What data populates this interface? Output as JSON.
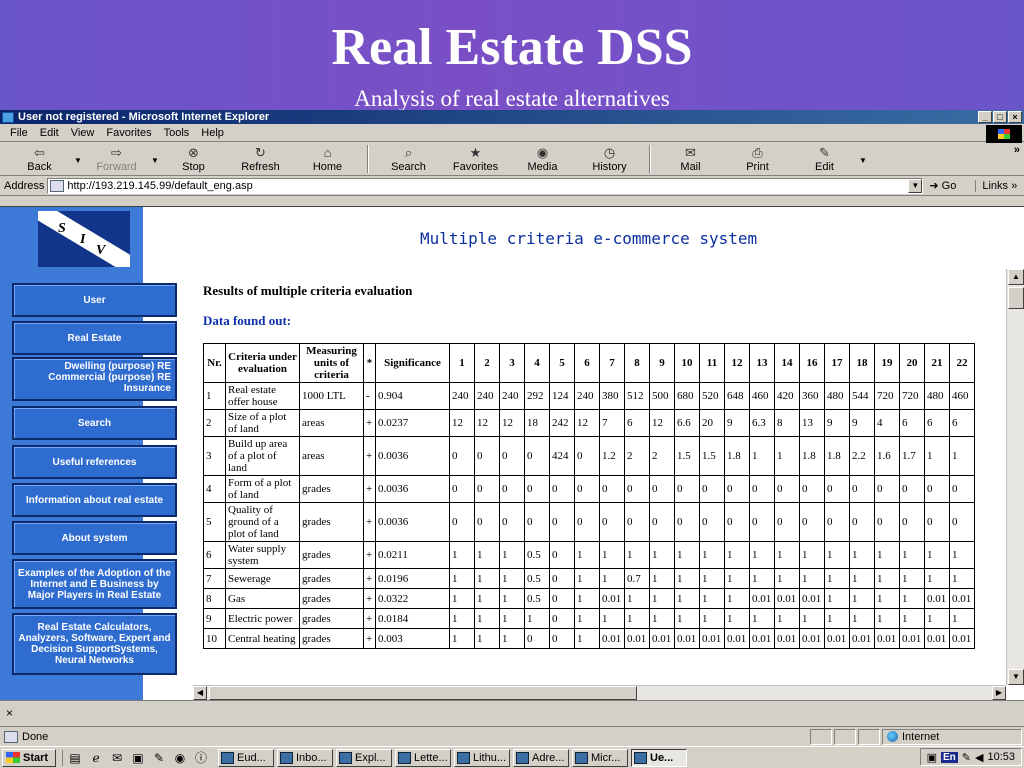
{
  "slide": {
    "title": "Real Estate DSS",
    "subtitle": "Analysis of real estate alternatives"
  },
  "window": {
    "title": "User not registered - Microsoft Internet Explorer",
    "buttons": {
      "minimize": "_",
      "maximize": "□",
      "close": "×"
    }
  },
  "menu": [
    "File",
    "Edit",
    "View",
    "Favorites",
    "Tools",
    "Help"
  ],
  "toolbar": {
    "back": "Back",
    "forward": "Forward",
    "stop": "Stop",
    "refresh": "Refresh",
    "home": "Home",
    "search": "Search",
    "favorites": "Favorites",
    "media": "Media",
    "history": "History",
    "mail": "Mail",
    "print": "Print",
    "edit": "Edit"
  },
  "address": {
    "label": "Address",
    "url": "http://193.219.145.99/default_eng.asp",
    "go": "Go",
    "links": "Links"
  },
  "logo": {
    "letters": [
      "S",
      "I",
      "V"
    ]
  },
  "sidebar": {
    "items": [
      {
        "label": "User"
      },
      {
        "label": "Real Estate"
      },
      {
        "label": "Dwelling (purpose) RE Commercial (purpose) RE Insurance"
      },
      {
        "label": "Search"
      },
      {
        "label": "Useful references"
      },
      {
        "label": "Information about real estate"
      },
      {
        "label": "About system"
      },
      {
        "label": "Examples of the Adoption of the Internet and E Business by Major Players in Real Estate"
      },
      {
        "label": "Real Estate Calculators, Analyzers, Software, Expert and Decision SupportSystems, Neural Networks"
      }
    ]
  },
  "page": {
    "title": "Multiple criteria e-commerce system",
    "results_title": "Results of multiple criteria evaluation",
    "data_found": "Data found out:"
  },
  "table": {
    "headers": {
      "nr": "Nr.",
      "criteria": "Criteria under evaluation",
      "units": "Measuring units of criteria",
      "sign": "*",
      "significance": "Significance",
      "alternatives": [
        "1",
        "2",
        "3",
        "4",
        "5",
        "6",
        "7",
        "8",
        "9",
        "10",
        "11",
        "12",
        "13",
        "14",
        "16",
        "17",
        "18",
        "19",
        "20",
        "21",
        "22"
      ]
    },
    "rows": [
      {
        "nr": "1",
        "criteria": "Real estate offer house",
        "units": "1000 LTL",
        "sign": "-",
        "significance": "0.904",
        "values": [
          "240",
          "240",
          "240",
          "292",
          "124",
          "240",
          "380",
          "512",
          "500",
          "680",
          "520",
          "648",
          "460",
          "420",
          "360",
          "480",
          "544",
          "720",
          "720",
          "480",
          "460"
        ]
      },
      {
        "nr": "2",
        "criteria": "Size of a plot of land",
        "units": "areas",
        "sign": "+",
        "significance": "0.0237",
        "values": [
          "12",
          "12",
          "12",
          "18",
          "242",
          "12",
          "7",
          "6",
          "12",
          "6.6",
          "20",
          "9",
          "6.3",
          "8",
          "13",
          "9",
          "9",
          "4",
          "6",
          "6",
          "6"
        ]
      },
      {
        "nr": "3",
        "criteria": "Build up area of a plot of land",
        "units": "areas",
        "sign": "+",
        "significance": "0.0036",
        "values": [
          "0",
          "0",
          "0",
          "0",
          "424",
          "0",
          "1.2",
          "2",
          "2",
          "1.5",
          "1.5",
          "1.8",
          "1",
          "1",
          "1.8",
          "1.8",
          "2.2",
          "1.6",
          "1.7",
          "1",
          "1"
        ]
      },
      {
        "nr": "4",
        "criteria": "Form of a plot of land",
        "units": "grades",
        "sign": "+",
        "significance": "0.0036",
        "values": [
          "0",
          "0",
          "0",
          "0",
          "0",
          "0",
          "0",
          "0",
          "0",
          "0",
          "0",
          "0",
          "0",
          "0",
          "0",
          "0",
          "0",
          "0",
          "0",
          "0",
          "0"
        ]
      },
      {
        "nr": "5",
        "criteria": "Quality of ground of a plot of land",
        "units": "grades",
        "sign": "+",
        "significance": "0.0036",
        "values": [
          "0",
          "0",
          "0",
          "0",
          "0",
          "0",
          "0",
          "0",
          "0",
          "0",
          "0",
          "0",
          "0",
          "0",
          "0",
          "0",
          "0",
          "0",
          "0",
          "0",
          "0"
        ]
      },
      {
        "nr": "6",
        "criteria": "Water supply system",
        "units": "grades",
        "sign": "+",
        "significance": "0.0211",
        "values": [
          "1",
          "1",
          "1",
          "0.5",
          "0",
          "1",
          "1",
          "1",
          "1",
          "1",
          "1",
          "1",
          "1",
          "1",
          "1",
          "1",
          "1",
          "1",
          "1",
          "1",
          "1"
        ]
      },
      {
        "nr": "7",
        "criteria": "Sewerage",
        "units": "grades",
        "sign": "+",
        "significance": "0.0196",
        "values": [
          "1",
          "1",
          "1",
          "0.5",
          "0",
          "1",
          "1",
          "0.7",
          "1",
          "1",
          "1",
          "1",
          "1",
          "1",
          "1",
          "1",
          "1",
          "1",
          "1",
          "1",
          "1"
        ]
      },
      {
        "nr": "8",
        "criteria": "Gas",
        "units": "grades",
        "sign": "+",
        "significance": "0.0322",
        "values": [
          "1",
          "1",
          "1",
          "0.5",
          "0",
          "1",
          "0.01",
          "1",
          "1",
          "1",
          "1",
          "1",
          "0.01",
          "0.01",
          "0.01",
          "1",
          "1",
          "1",
          "1",
          "0.01",
          "0.01"
        ]
      },
      {
        "nr": "9",
        "criteria": "Electric power",
        "units": "grades",
        "sign": "+",
        "significance": "0.0184",
        "values": [
          "1",
          "1",
          "1",
          "1",
          "0",
          "1",
          "1",
          "1",
          "1",
          "1",
          "1",
          "1",
          "1",
          "1",
          "1",
          "1",
          "1",
          "1",
          "1",
          "1",
          "1"
        ]
      },
      {
        "nr": "10",
        "criteria": "Central heating",
        "units": "grades",
        "sign": "+",
        "significance": "0.003",
        "values": [
          "1",
          "1",
          "1",
          "0",
          "0",
          "1",
          "0.01",
          "0.01",
          "0.01",
          "0.01",
          "0.01",
          "0.01",
          "0.01",
          "0.01",
          "0.01",
          "0.01",
          "0.01",
          "0.01",
          "0.01",
          "0.01",
          "0.01"
        ]
      }
    ]
  },
  "closebar": {
    "label": "×"
  },
  "status": {
    "text": "Done",
    "zone": "Internet"
  },
  "taskbar": {
    "start": "Start",
    "tasks": [
      "Eud...",
      "Inbo...",
      "Expl...",
      "Lette...",
      "Lithu...",
      "Adre...",
      "Micr...",
      "Ue..."
    ],
    "lang": "En",
    "clock": "10:53"
  }
}
